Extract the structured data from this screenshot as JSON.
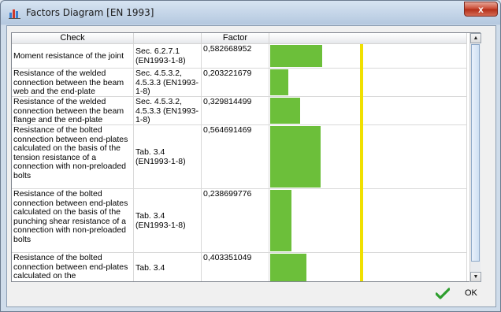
{
  "window": {
    "title": "Factors Diagram [EN 1993]",
    "close_label": "x"
  },
  "table": {
    "headers": [
      "Check",
      "",
      "Factor",
      ""
    ],
    "rows": [
      {
        "check": "Moment resistance of the joint",
        "ref": "Sec. 6.2.7.1 (EN1993-1-8)",
        "factor": "0,582668952",
        "value": 0.582668952
      },
      {
        "check": "Resistance of the welded connection between the beam web and the end-plate",
        "ref": "Sec. 4.5.3.2, 4.5.3.3 (EN1993-1-8)",
        "factor": "0,203221679",
        "value": 0.203221679
      },
      {
        "check": "Resistance of the welded connection between the beam flange and the end-plate",
        "ref": "Sec. 4.5.3.2, 4.5.3.3 (EN1993-1-8)",
        "factor": "0,329814499",
        "value": 0.329814499
      },
      {
        "check": "Resistance of the bolted connection between end-plates calculated on the basis of the tension resistance of a connection with non-preloaded bolts",
        "ref": "Tab. 3.4 (EN1993-1-8)",
        "factor": "0,564691469",
        "value": 0.564691469
      },
      {
        "check": "Resistance of the bolted connection between end-plates calculated on the basis of the punching shear resistance of a connection with non-preloaded bolts",
        "ref": "Tab. 3.4 (EN1993-1-8)",
        "factor": "0,238699776",
        "value": 0.238699776
      },
      {
        "check": "Resistance of the bolted connection between end-plates calculated on the",
        "ref": "Tab. 3.4",
        "factor": "0,403351049",
        "value": 0.403351049
      }
    ],
    "bar_color": "#6cbf3a",
    "limit_color": "#f0e000",
    "limit_value": 1.0
  },
  "footer": {
    "ok_label": "OK"
  }
}
